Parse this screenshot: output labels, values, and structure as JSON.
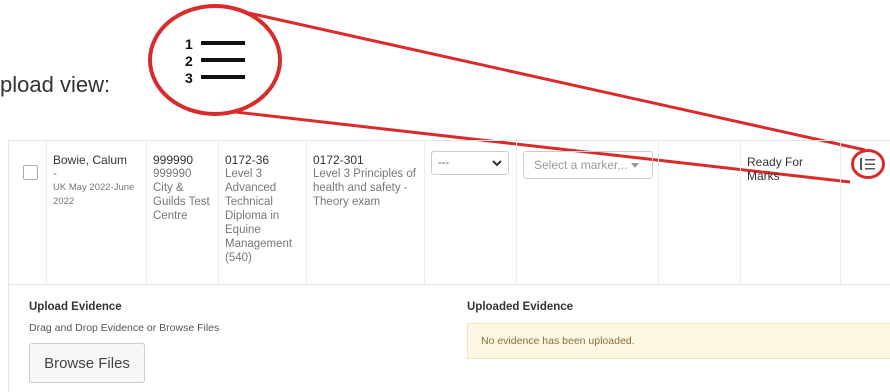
{
  "caption": {
    "text": "pload view:"
  },
  "zoom": {
    "icon": "numbered-list-icon",
    "accent": "#d92b2b"
  },
  "row": {
    "learner_name": "Bowie, Calum",
    "learner_dash": "-",
    "learner_session": "UK May 2022-June 2022",
    "centre_number": "999990",
    "centre_name": "999990 City & Guilds Test Centre",
    "qualification_code": "0172-36",
    "qualification_name": "Level 3 Advanced Technical Diploma in Equine Management (540)",
    "component_code": "0172-301",
    "component_name": "Level 3 Principles of health and safety - Theory exam",
    "select_value": "---",
    "marker_placeholder": "Select a marker...",
    "status": "Ready For Marks"
  },
  "upload": {
    "title": "Upload Evidence",
    "subtitle": "Drag and Drop Evidence or Browse Files",
    "browse_label": "Browse Files"
  },
  "evidence": {
    "title": "Uploaded Evidence",
    "empty_message": "No evidence has been uploaded."
  }
}
